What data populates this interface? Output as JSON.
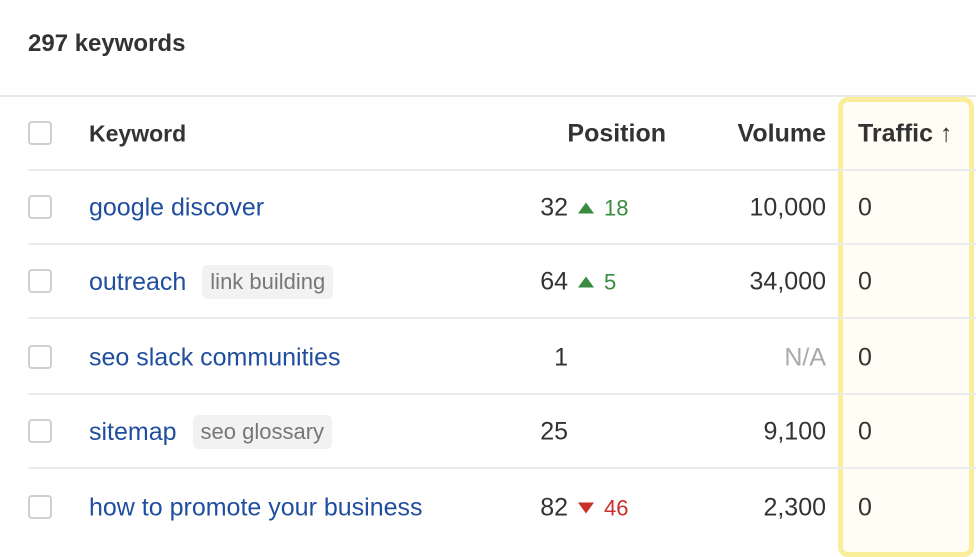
{
  "title": "297 keywords",
  "highlight_color": "#f9ee9c",
  "columns": {
    "keyword": "Keyword",
    "position": "Position",
    "volume": "Volume",
    "traffic": "Traffic",
    "sort_icon": "arrow-up-icon",
    "sort_glyph": "↑"
  },
  "rows": [
    {
      "keyword": "google discover",
      "tag": "",
      "position": "32",
      "change": "18",
      "direction": "up",
      "volume": "10,000",
      "traffic": "0"
    },
    {
      "keyword": "outreach",
      "tag": "link building",
      "position": "64",
      "change": "5",
      "direction": "up",
      "volume": "34,000",
      "traffic": "0"
    },
    {
      "keyword": "seo slack communities",
      "tag": "",
      "position": "1",
      "change": "",
      "direction": "",
      "volume": "N/A",
      "traffic": "0"
    },
    {
      "keyword": "sitemap",
      "tag": "seo glossary",
      "position": "25",
      "change": "",
      "direction": "",
      "volume": "9,100",
      "traffic": "0"
    },
    {
      "keyword": "how to promote your business",
      "tag": "",
      "position": "82",
      "change": "46",
      "direction": "down",
      "volume": "2,300",
      "traffic": "0"
    }
  ]
}
